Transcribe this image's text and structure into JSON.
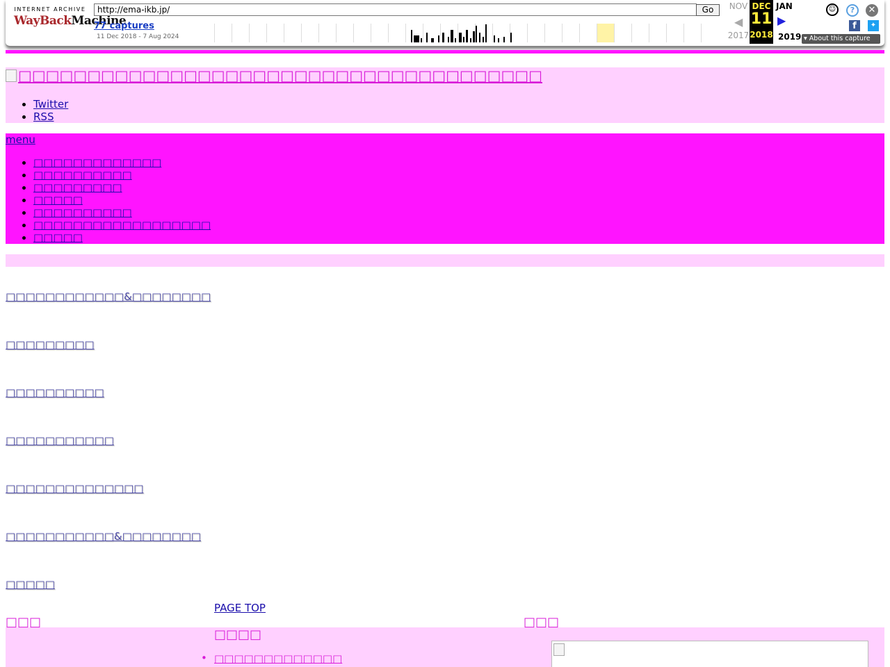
{
  "wayback": {
    "logo_top": "INTERNET ARCHIVE",
    "logo_red": "WayBack",
    "logo_black": "Machine",
    "url": "http://ema-ikb.jp/",
    "go_label": "Go",
    "captures": "77 captures",
    "range": "11 Dec 2018 - 7 Aug 2024",
    "prev_month": "NOV",
    "prev_year": "2017",
    "cur_month": "DEC",
    "cur_day": "11",
    "cur_year": "2018",
    "next_month": "JAN",
    "next_year": "2019",
    "about": "About this capture"
  },
  "header": {
    "logo_text": "□□□□□□□□□□□□□□□□□□□□□□□□□□□□□□□□□□□□□□",
    "social": [
      "Twitter",
      "RSS"
    ]
  },
  "nav": {
    "menu_label": "menu",
    "items": [
      "□□□□□□□□□□□□□",
      "□□□□□□□□□□",
      "□□□□□□□□□",
      "□□□□□",
      "□□□□□□□□□□",
      "□□□□□□□□□□□□□□□□□□",
      "□□□□□"
    ]
  },
  "categories": [
    "□□□□□□□□□□□□&□□□□□□□□",
    "□□□□□□□□□",
    "□□□□□□□□□□",
    "□□□□□□□□□□□",
    "□□□□□□□□□□□□□□",
    "□□□□□□□□□□□&□□□□□□□□",
    "□□□□□"
  ],
  "footer": {
    "page_top": "PAGE TOP",
    "heading_left": "□□□",
    "heading_mid": "□□□□",
    "heading_right": "□□□",
    "list": [
      "□□□□□□□□□□□□□"
    ]
  },
  "colors": {
    "magenta": "#ff14ff",
    "light_pink": "#ffd0ff",
    "link": "#1a0dab"
  }
}
